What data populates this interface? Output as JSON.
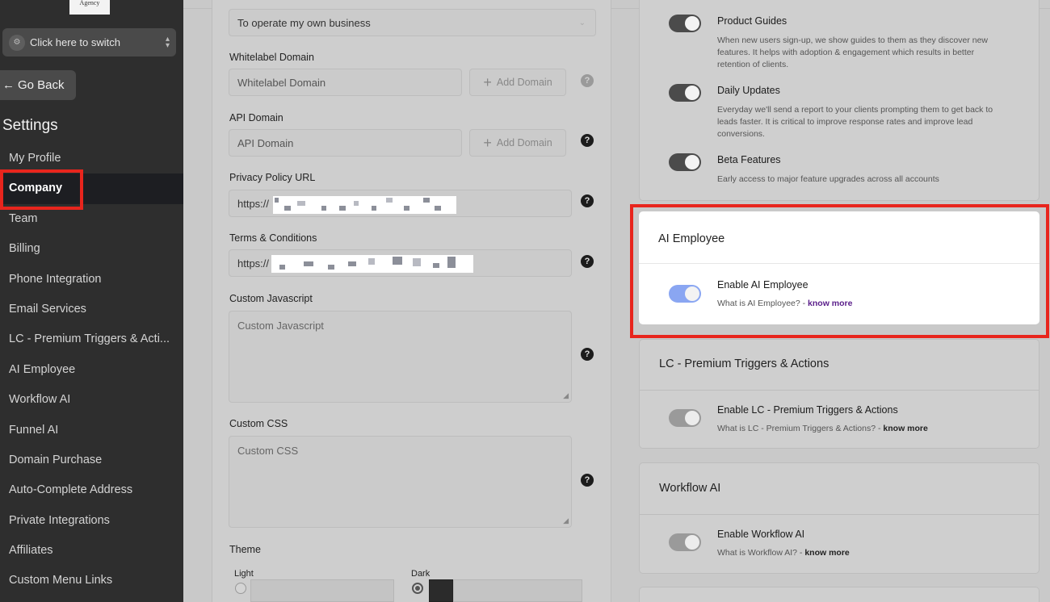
{
  "sidebar": {
    "logo_text": "Agency",
    "switcher_label": "Click here to switch",
    "go_back_label": "Go Back",
    "settings_title": "Settings",
    "items": [
      {
        "label": "My Profile"
      },
      {
        "label": "Company"
      },
      {
        "label": "Team"
      },
      {
        "label": "Billing"
      },
      {
        "label": "Phone Integration"
      },
      {
        "label": "Email Services"
      },
      {
        "label": "LC - Premium Triggers & Acti..."
      },
      {
        "label": "AI Employee"
      },
      {
        "label": "Workflow AI"
      },
      {
        "label": "Funnel AI"
      },
      {
        "label": "Domain Purchase"
      },
      {
        "label": "Auto-Complete Address"
      },
      {
        "label": "Private Integrations"
      },
      {
        "label": "Affiliates"
      },
      {
        "label": "Custom Menu Links"
      }
    ],
    "active_item": "Company"
  },
  "form": {
    "purpose_select_value": "To operate my own business",
    "whitelabel": {
      "label": "Whitelabel Domain",
      "placeholder": "Whitelabel Domain",
      "add_label": "Add Domain"
    },
    "api": {
      "label": "API Domain",
      "placeholder": "API Domain",
      "add_label": "Add Domain"
    },
    "privacy": {
      "label": "Privacy Policy URL",
      "value_prefix": "https://"
    },
    "terms": {
      "label": "Terms & Conditions",
      "value_prefix": "https://"
    },
    "custom_js": {
      "label": "Custom Javascript",
      "placeholder": "Custom Javascript"
    },
    "custom_css": {
      "label": "Custom CSS",
      "placeholder": "Custom CSS"
    },
    "theme": {
      "label": "Theme",
      "light_label": "Light",
      "dark_label": "Dark",
      "selected": "Dark"
    },
    "help_glyph": "?"
  },
  "features": {
    "product_guides": {
      "title": "Product Guides",
      "desc": "When new users sign-up, we show guides to them as they discover new features. It helps with adoption & engagement which results in better retention of clients.",
      "enabled": true
    },
    "daily_updates": {
      "title": "Daily Updates",
      "desc": "Everyday we'll send a report to your clients prompting them to get back to leads faster. It is critical to improve response rates and improve lead conversions.",
      "enabled": true
    },
    "beta_features": {
      "title": "Beta Features",
      "desc": "Early access to major feature upgrades across all accounts",
      "enabled": true
    }
  },
  "ai_employee": {
    "header": "AI Employee",
    "toggle_title": "Enable AI Employee",
    "desc_prefix": "What is AI Employee? - ",
    "know_more": "know more",
    "enabled": true
  },
  "lc_premium": {
    "header": "LC - Premium Triggers & Actions",
    "toggle_title": "Enable LC - Premium Triggers & Actions",
    "desc_prefix": "What is LC - Premium Triggers & Actions? - ",
    "know_more": "know more",
    "enabled": false
  },
  "workflow_ai": {
    "header": "Workflow AI",
    "toggle_title": "Enable Workflow AI",
    "desc_prefix": "What is Workflow AI? - ",
    "know_more": "know more",
    "enabled": false
  },
  "colors": {
    "highlight_red": "#e8251d",
    "toggle_on_blue": "#8aa6f2",
    "sidebar_bg": "#2e2e2e"
  }
}
